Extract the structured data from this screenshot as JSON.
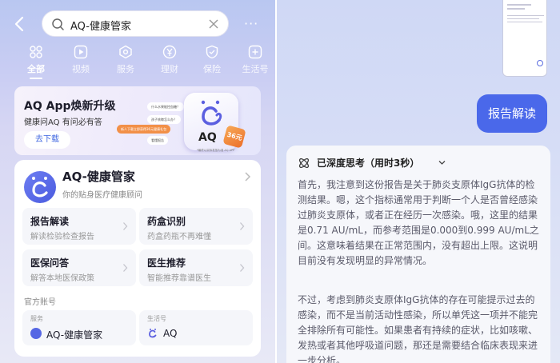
{
  "left": {
    "search": {
      "query": "AQ-健康管家",
      "more": "···"
    },
    "tabs": [
      {
        "label": "全部",
        "icon": "grid-icon",
        "active": true
      },
      {
        "label": "视频",
        "icon": "play-icon",
        "active": false
      },
      {
        "label": "服务",
        "icon": "service-icon",
        "active": false
      },
      {
        "label": "理财",
        "icon": "yen-icon",
        "active": false
      },
      {
        "label": "保险",
        "icon": "shield-icon",
        "active": false
      },
      {
        "label": "生活号",
        "icon": "life-icon",
        "active": false
      }
    ],
    "banner": {
      "title": "AQ App焕新升级",
      "subtitle": "健康问AQ 有问必有答",
      "button": "去下载",
      "pills": [
        "什么水果能控血糖？",
        "孩子咳嗽怎么办？",
        "看懂报告",
        "新人下载立即获得36元健康礼包"
      ],
      "app_name": "AQ",
      "badge": "36元",
      "fineprint": "*最终以实际发放为准 AQ APP"
    },
    "service": {
      "name": "AQ-健康管家",
      "tagline": "你的贴身医疗健康顾问",
      "tiles": [
        {
          "title": "报告解读",
          "subtitle": "解读检验检查报告"
        },
        {
          "title": "药盒识别",
          "subtitle": "药盒药瓶不再难懂"
        },
        {
          "title": "医保问答",
          "subtitle": "解答本地医保政策"
        },
        {
          "title": "医生推荐",
          "subtitle": "智能推荐靠谱医生"
        }
      ],
      "official_label": "官方账号",
      "accounts": [
        {
          "type": "服务",
          "name": "AQ-健康管家"
        },
        {
          "type": "生活号",
          "name": "AQ"
        }
      ]
    }
  },
  "right": {
    "bubble": "报告解读",
    "thinking": "已深度思考（用时3秒）",
    "paragraphs": [
      "首先，我注意到这份报告是关于肺炎支原体IgG抗体的检测结果。嗯，这个指标通常用于判断一个人是否曾经感染过肺炎支原体，或者正在经历一次感染。哦，这里的结果是0.71 AU/mL，而参考范围是0.000到0.999 AU/mL之间。这意味着结果在正常范围内，没有超出上限。这说明目前没有发现明显的异常情况。",
      "不过，考虑到肺炎支原体IgG抗体的存在可能提示过去的感染，而不是当前活动性感染，所以单凭这一项并不能完全排除所有可能性。如果患者有持续的症状，比如咳嗽、发热或者其他呼吸道问题，那还是需要结合临床表现来进一步分析。"
    ]
  }
}
